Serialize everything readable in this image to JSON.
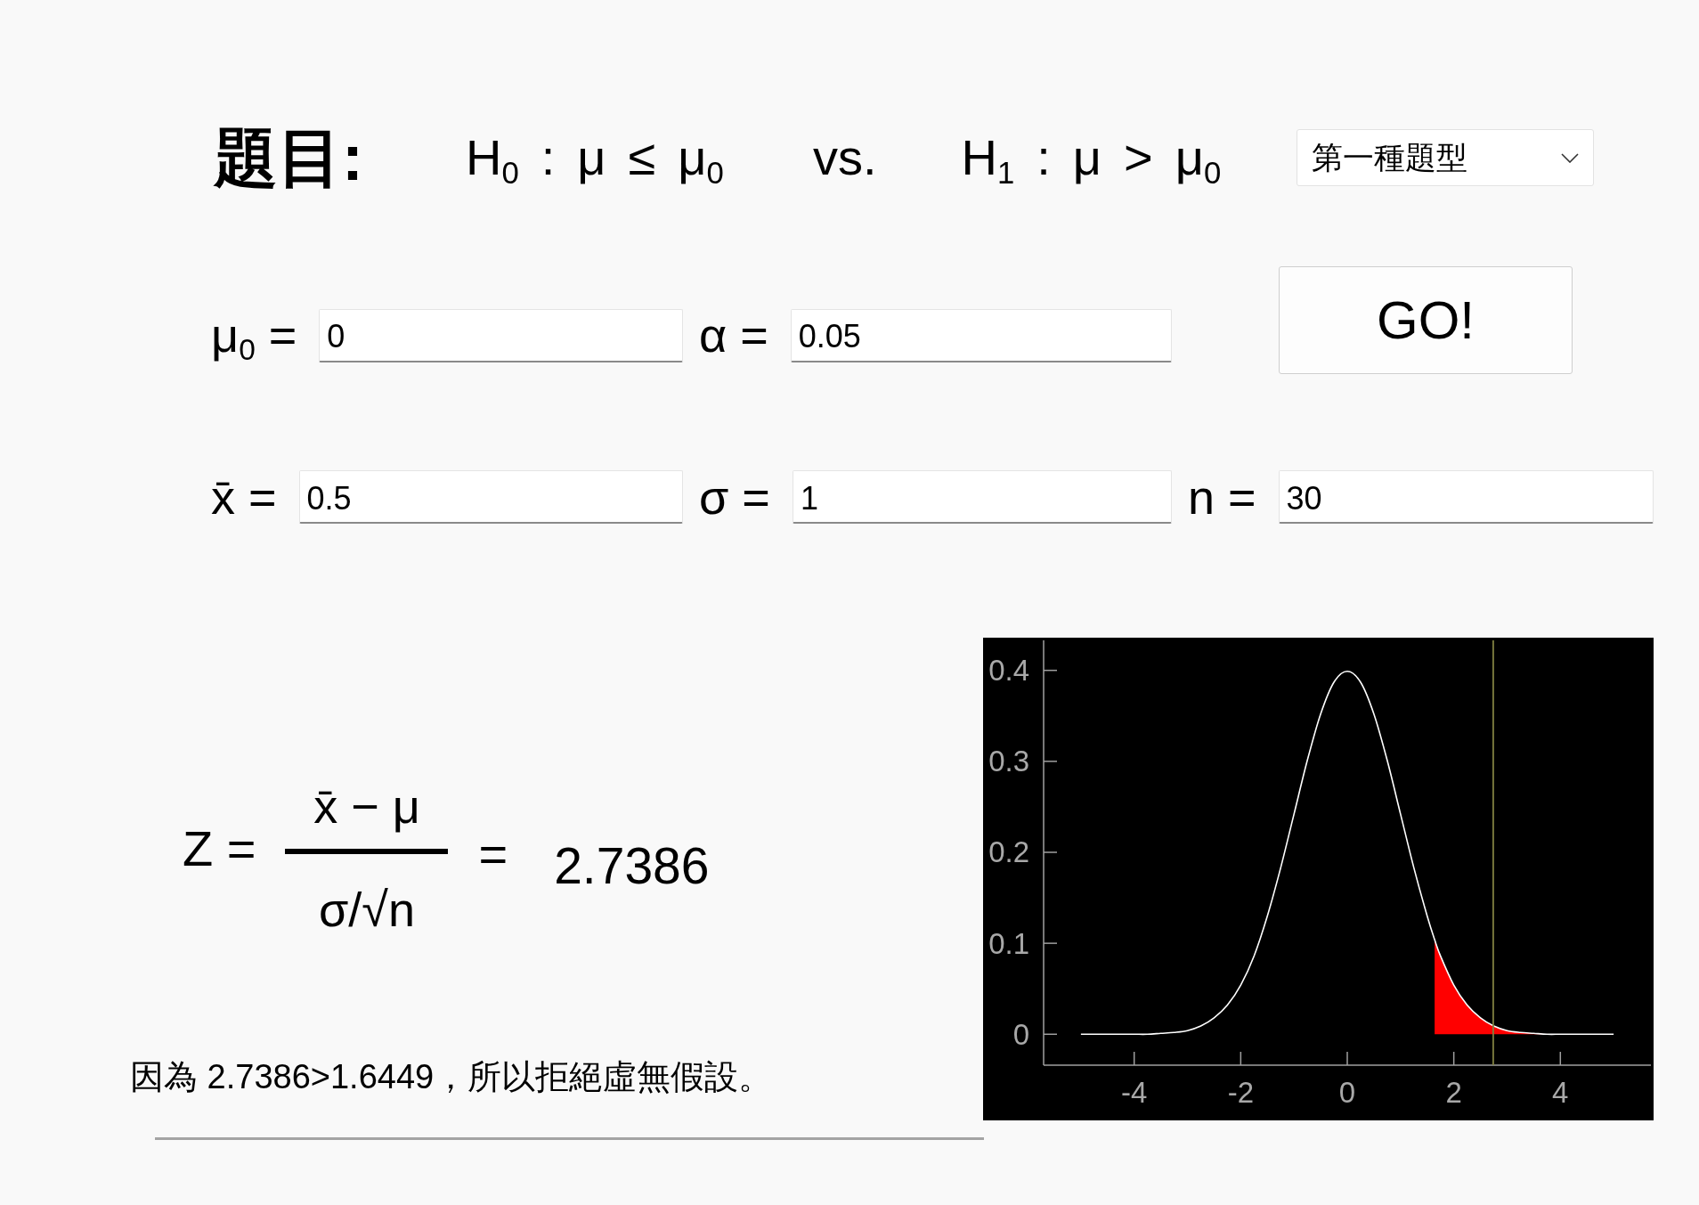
{
  "header": {
    "title": "題目:",
    "null_hypothesis": [
      "H$_{0}$",
      ":",
      "μ",
      "≤",
      "μ$_{0}$"
    ],
    "versus": "vs.",
    "alternative_hypothesis": [
      "H$_{1}$",
      ":",
      "μ",
      ">",
      "μ$_{0}$"
    ],
    "question_type": {
      "value": "第一種題型"
    }
  },
  "form": {
    "rows": [
      {
        "fields": [
          {
            "label": "μ$_{0}$ =",
            "value": "0"
          },
          {
            "label": "α =",
            "value": "0.05"
          }
        ],
        "button": "GO!"
      },
      {
        "fields": [
          {
            "label": "x̄ =",
            "value": "0.5"
          },
          {
            "label": "σ =",
            "value": "1"
          },
          {
            "label": "n =",
            "value": "30"
          }
        ]
      }
    ]
  },
  "formula": {
    "lhs": "Z =",
    "numerator": "x̄ − μ",
    "denominator": "σ/√n",
    "equals": "=",
    "result": "2.7386"
  },
  "conclusion": "因為 2.7386>1.6449，所以拒絕虛無假設。",
  "chart": {
    "chart_data": {
      "type": "line",
      "x": [
        -5,
        -4.75,
        -4.5,
        -4.25,
        -4,
        -3.75,
        -3.5,
        -3.25,
        -3,
        -2.75,
        -2.5,
        -2.25,
        -2,
        -1.75,
        -1.5,
        -1.25,
        -1,
        -0.75,
        -0.5,
        -0.25,
        0,
        0.25,
        0.5,
        0.75,
        1,
        1.25,
        1.5,
        1.64,
        1.75,
        2,
        2.25,
        2.5,
        2.75,
        3,
        3.25,
        3.5,
        3.75,
        4,
        4.25,
        4.5,
        4.75,
        5
      ],
      "series": [
        {
          "type": "area",
          "color": "#ff0000",
          "values": [
            null,
            null,
            null,
            null,
            null,
            null,
            null,
            null,
            null,
            null,
            null,
            null,
            null,
            null,
            null,
            null,
            null,
            null,
            null,
            null,
            null,
            null,
            null,
            null,
            null,
            null,
            null,
            0.104,
            0.086,
            0.054,
            0.032,
            0.018,
            0.009,
            0.004,
            0.002,
            0.001,
            0,
            0,
            0,
            0,
            0,
            0
          ]
        },
        {
          "type": "line",
          "color": "#ffffff",
          "values": [
            0,
            0,
            0,
            0,
            0,
            0,
            0.001,
            0.002,
            0.004,
            0.009,
            0.018,
            0.032,
            0.054,
            0.086,
            0.13,
            0.183,
            0.242,
            0.301,
            0.352,
            0.387,
            0.399,
            0.387,
            0.352,
            0.301,
            0.242,
            0.183,
            0.13,
            0.104,
            0.086,
            0.054,
            0.032,
            0.018,
            0.009,
            0.004,
            0.002,
            0.001,
            0,
            0,
            0,
            0,
            0,
            0
          ]
        }
      ],
      "xlim": [
        -5.7,
        5.7
      ],
      "ylim": [
        -0.034,
        0.433
      ],
      "xticks": [
        -4,
        -2,
        0,
        2,
        4
      ],
      "yticks": [
        0,
        0.1,
        0.2,
        0.3,
        0.4
      ],
      "ref_lines": [
        {
          "axis": "x",
          "value": 2.74,
          "color": "#808040"
        }
      ]
    }
  }
}
